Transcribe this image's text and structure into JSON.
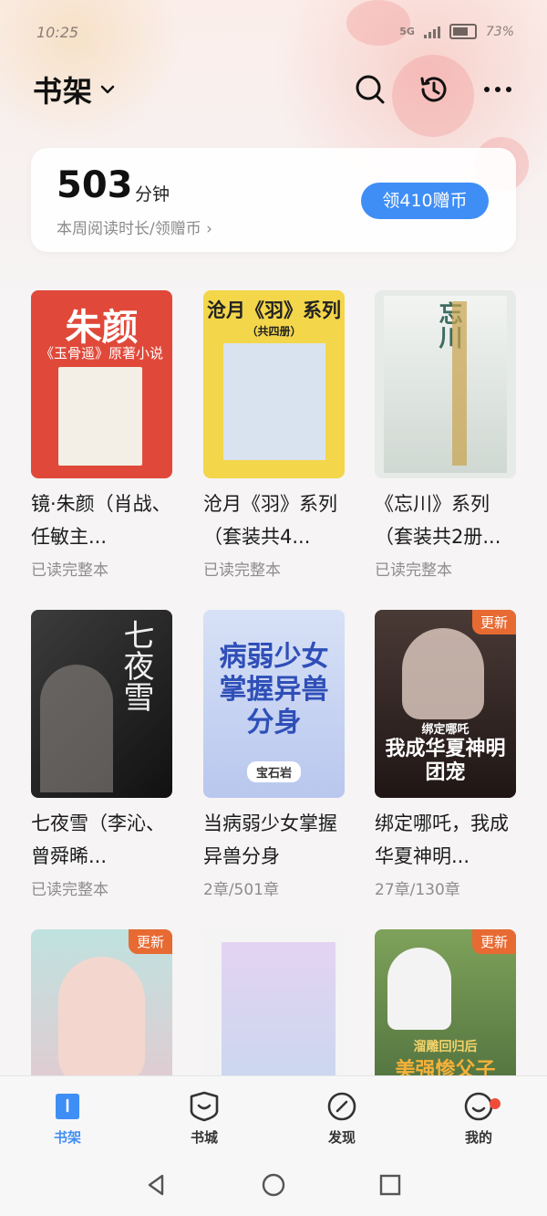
{
  "status": {
    "time": "10:25",
    "network": "5G",
    "battery": "73%"
  },
  "header": {
    "title": "书架"
  },
  "reading": {
    "minutes": "503",
    "unit": "分钟",
    "subtitle": "本周阅读时长/领赠币 ›",
    "button": "领410赠币"
  },
  "books": [
    {
      "title": "镜·朱颜（肖战、任敏主...",
      "meta": "已读完整本",
      "badge": "",
      "cover_text": "朱颜",
      "cover_sub": "《玉骨遥》原著小说",
      "cover_color": "#e0493a"
    },
    {
      "title": "沧月《羽》系列（套装共4...",
      "meta": "已读完整本",
      "badge": "",
      "cover_text": "沧月《羽》系列",
      "cover_sub": "（共四册）",
      "cover_color": "#f3d64a"
    },
    {
      "title": "《忘川》系列（套装共2册...",
      "meta": "已读完整本",
      "badge": "",
      "cover_text": "忘川",
      "cover_sub": "",
      "cover_color": "#e7ebe8"
    },
    {
      "title": "七夜雪（李沁、曾舜晞...",
      "meta": "已读完整本",
      "badge": "",
      "cover_text": "七夜雪",
      "cover_sub": "",
      "cover_color": "#2a2a2a"
    },
    {
      "title": "当病弱少女掌握异兽分身",
      "meta": "2章/501章",
      "badge": "",
      "cover_text": "病弱少女掌握异兽分身",
      "cover_sub": "宝石岩",
      "cover_color": "#c9d6f2"
    },
    {
      "title": "绑定哪吒，我成华夏神明...",
      "meta": "27章/130章",
      "badge": "更新",
      "cover_text": "我成华夏神明团宠",
      "cover_sub": "绑定哪吒",
      "cover_color": "#3a2a26"
    },
    {
      "title": "",
      "meta": "",
      "badge": "更新",
      "cover_text": "",
      "cover_sub": "",
      "cover_color": "#e9c7d3"
    },
    {
      "title": "",
      "meta": "",
      "badge": "",
      "cover_text": "",
      "cover_sub": "",
      "cover_color": "#e3def0"
    },
    {
      "title": "",
      "meta": "",
      "badge": "更新",
      "cover_text": "美强惨父子",
      "cover_sub": "溜雕回归后",
      "cover_color": "#6e8a4c"
    }
  ],
  "tabs": [
    {
      "label": "书架",
      "icon": "bookshelf-icon"
    },
    {
      "label": "书城",
      "icon": "bookstore-icon"
    },
    {
      "label": "发现",
      "icon": "discover-icon"
    },
    {
      "label": "我的",
      "icon": "profile-icon"
    }
  ],
  "colors": {
    "accent": "#3f8ef5",
    "badge": "#e86a33"
  }
}
